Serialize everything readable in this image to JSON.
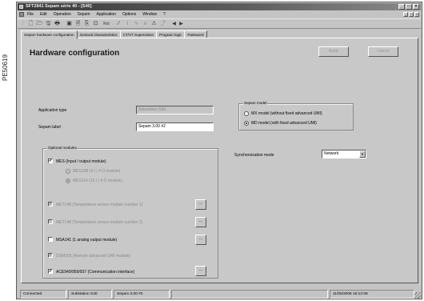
{
  "side_label": "PE50619",
  "window": {
    "title": "SFT2841 Sepam série 40 - [S40]",
    "buttons": [
      "_",
      "□",
      "×"
    ]
  },
  "menubar": {
    "items": [
      "File",
      "Edit",
      "Operation",
      "Sepam",
      "Application",
      "Options",
      "Window",
      "?"
    ],
    "mdi_buttons": [
      "_",
      "□",
      "×"
    ]
  },
  "toolbar": {
    "items": [
      {
        "icon": "separator-grip",
        "glyph": "⁞"
      },
      {
        "icon": "new-file-icon",
        "glyph": "🗋"
      },
      {
        "icon": "open-folder-icon",
        "glyph": "🗁"
      },
      {
        "icon": "save-icon",
        "glyph": "🖫"
      },
      {
        "icon": "print-icon",
        "glyph": "🖶"
      },
      {
        "icon": "disk-icon",
        "glyph": "▣"
      },
      {
        "icon": "preview-icon",
        "glyph": "🗎"
      },
      {
        "icon": "copy-to-sepam-icon",
        "glyph": "⎘"
      },
      {
        "icon": "connect-icon",
        "glyph": "⊡"
      },
      {
        "icon": "rst-label",
        "glyph": "Rst"
      },
      {
        "icon": "wand-icon",
        "glyph": "⁄"
      },
      {
        "icon": "dim-tool-1-icon",
        "glyph": "⌇"
      },
      {
        "icon": "dim-tool-2-icon",
        "glyph": "∿"
      },
      {
        "icon": "dim-tool-3-icon",
        "glyph": "∨"
      },
      {
        "icon": "warning-icon",
        "glyph": "⚠"
      },
      {
        "icon": "dim-tool-4-icon",
        "glyph": "⤴"
      },
      {
        "icon": "arrow-left-icon",
        "glyph": "◀"
      },
      {
        "icon": "arrow-right-icon",
        "glyph": "▶"
      }
    ]
  },
  "tabs": [
    {
      "label": "Sepam hardware configuration",
      "active": true
    },
    {
      "label": "General characteristics",
      "active": false
    },
    {
      "label": "CT/VT Supervision",
      "active": false
    },
    {
      "label": "Program logic",
      "active": false
    },
    {
      "label": "Password",
      "active": false
    }
  ],
  "page": {
    "heading": "Hardware configuration",
    "apply_label": "Apply",
    "cancel_label": "Cancel",
    "application_type_label": "Application type",
    "application_type_value": "Substation S40",
    "sepam_label_label": "Sepam label",
    "sepam_label_value": "Sepam 3.00 #2"
  },
  "sepam_model": {
    "title": "Sepam model",
    "options": [
      {
        "label": "MX model (without fixed advanced UMI)",
        "selected": false
      },
      {
        "label": "MD model (with fixed advanced UMI)",
        "selected": true
      }
    ]
  },
  "sync": {
    "label": "Synchronization mode",
    "value": "Network",
    "arrow": "▼"
  },
  "optional_modules": {
    "title": "Optional modules",
    "mes": {
      "label": "MES (Input / output module)",
      "checked": true,
      "sub_options": [
        {
          "label": "MES108 (4 I / 4 O module)",
          "selected": false
        },
        {
          "label": "MES114 (10 I / 4 O module)",
          "selected": true
        }
      ]
    },
    "modules": [
      {
        "label": "MET148 (Temperature sensor module number 1)",
        "checked": true,
        "disabled": true,
        "has_button": true
      },
      {
        "label": "MET148 (Temperature sensor module number 2)",
        "checked": false,
        "disabled": true,
        "has_button": true
      },
      {
        "label": "MSA141 (1 analog output module)",
        "checked": false,
        "disabled": false,
        "has_button": true
      },
      {
        "label": "DSM303 (Remote advanced UMI module)",
        "checked": true,
        "disabled": true,
        "has_button": false
      },
      {
        "label": "ACE949/959/937 (Communication interface)",
        "checked": true,
        "disabled": false,
        "has_button": true
      }
    ],
    "ellipsis": "..."
  },
  "statusbar": {
    "status": "Connected",
    "application": "Substation S40",
    "sepam": "Sepam 3.00 #2",
    "datetime": "11/05/2006 16:12:08"
  }
}
